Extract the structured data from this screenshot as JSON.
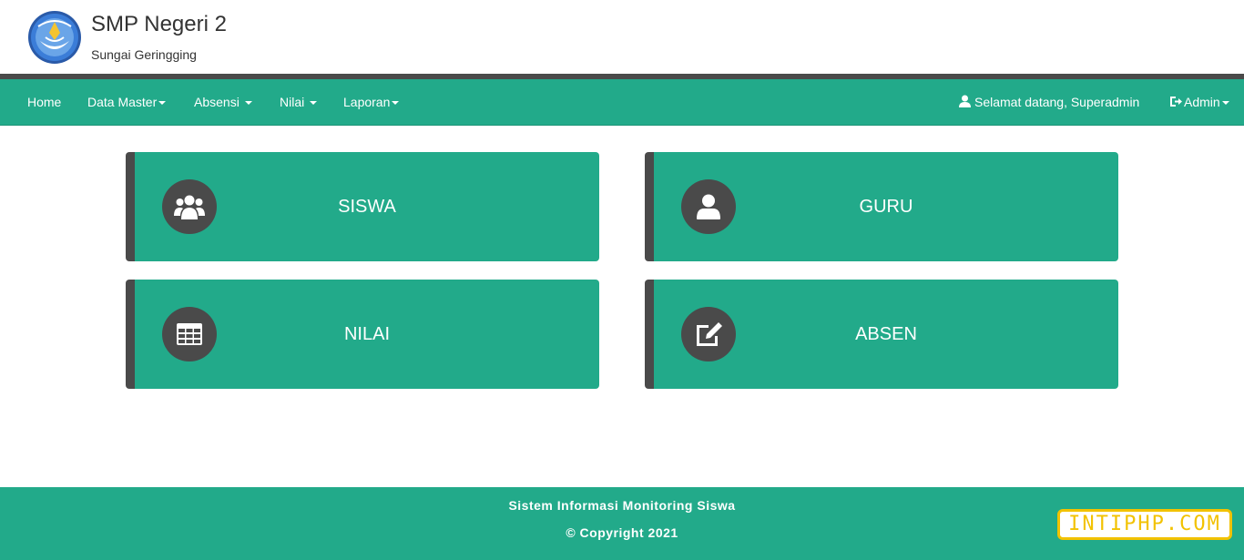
{
  "header": {
    "title": "SMP Negeri 2",
    "subtitle": "Sungai Geringging",
    "logo_icon": "school-emblem-icon"
  },
  "navbar": {
    "items": [
      {
        "label": "Home"
      },
      {
        "label": "Data Master"
      },
      {
        "label": "Absensi"
      },
      {
        "label": "Nilai"
      },
      {
        "label": "Laporan"
      }
    ],
    "welcome": "Selamat datang, Superadmin",
    "account": "Admin"
  },
  "cards": [
    {
      "label": "SISWA",
      "icon": "users-icon"
    },
    {
      "label": "GURU",
      "icon": "user-icon"
    },
    {
      "label": "NILAI",
      "icon": "table-icon"
    },
    {
      "label": "ABSEN",
      "icon": "edit-icon"
    }
  ],
  "footer": {
    "line1": "Sistem Informasi Monitoring Siswa",
    "line2": "© Copyright 2021"
  },
  "watermark": "INTIPHP.COM",
  "colors": {
    "primary": "#22aa8a",
    "dark": "#4a4a4a",
    "watermark": "#f2c200"
  }
}
